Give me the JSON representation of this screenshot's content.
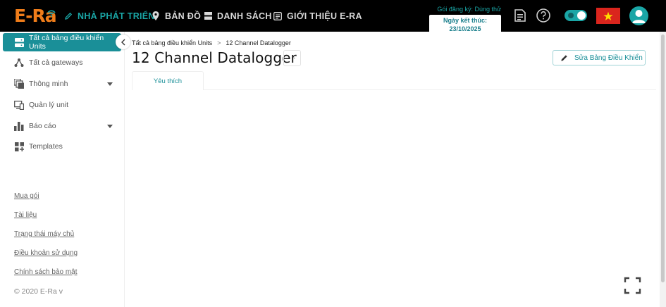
{
  "app": {
    "logo_text": "E-Ra"
  },
  "topnav": {
    "developer": "NHÀ PHÁT TRIỂN",
    "map": "BẢN ĐỒ",
    "list": "DANH SÁCH",
    "about": "GIỚI THIỆU E-RA"
  },
  "plan": {
    "label": "Gói đăng ký: Dùng thử",
    "expire": "Ngày kết thúc: 23/10/2025"
  },
  "icons": {
    "notes": "notes-icon",
    "help": "help-icon",
    "theme": "theme-toggle",
    "flag": "vietnam-flag-icon",
    "user": "user-avatar-icon"
  },
  "colors": {
    "accent": "#1aa6a6",
    "logo": "#f07d1a",
    "active": "#1a8f98",
    "flag_red": "#da251d",
    "flag_star": "#ffde00"
  },
  "sidebar": {
    "items": [
      {
        "label": "Tất cả bảng điều khiển Units",
        "icon": "dashboard-icon",
        "active": true
      },
      {
        "label": "Tất cả gateways",
        "icon": "gateway-icon"
      },
      {
        "label": "Thông minh",
        "icon": "smart-icon",
        "expandable": true
      },
      {
        "label": "Quản lý unit",
        "icon": "unit-icon"
      },
      {
        "label": "Báo cáo",
        "icon": "report-icon",
        "expandable": true
      },
      {
        "label": "Templates",
        "icon": "templates-icon"
      }
    ],
    "links": [
      "Mua gói",
      "Tài liệu",
      "Trạng thái máy chủ",
      "Điều khoản sử dụng",
      "Chính sách bảo mật"
    ],
    "copyright": "© 2020 E-Ra v"
  },
  "breadcrumb": {
    "parent": "Tất cả bảng điều khiển Units",
    "separator": ">",
    "current": "12 Channel Datalogger"
  },
  "page": {
    "title": "12 Channel Datalogger",
    "more_label": "···",
    "edit_label": "Sửa Bảng Điều Khiển"
  },
  "tabs": [
    {
      "label": "Yêu thích",
      "active": true
    }
  ]
}
